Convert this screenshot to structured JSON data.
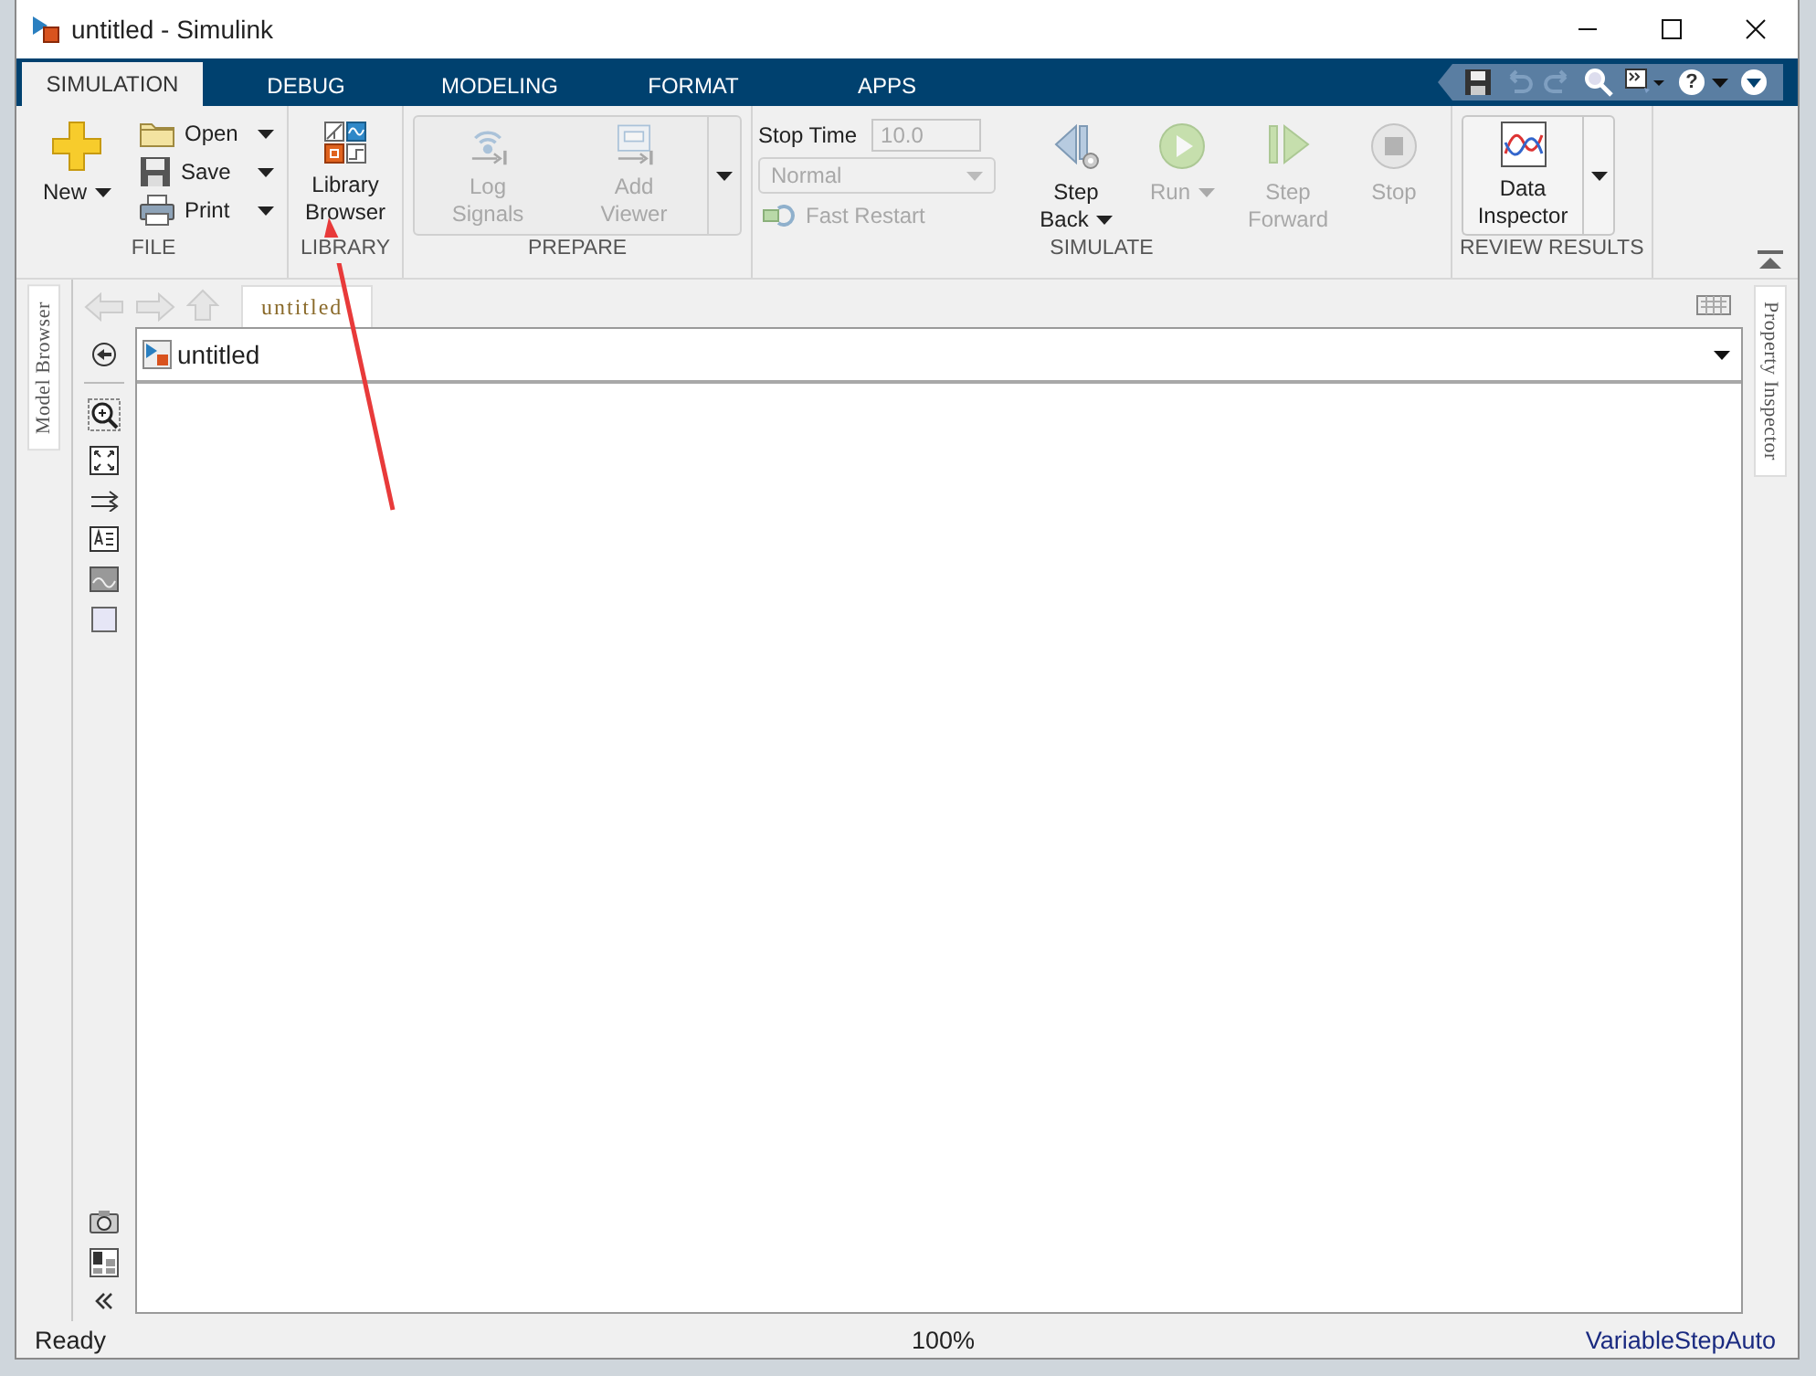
{
  "window": {
    "title": "untitled - Simulink"
  },
  "tabs": [
    {
      "label": "SIMULATION",
      "selected": true
    },
    {
      "label": "DEBUG",
      "selected": false
    },
    {
      "label": "MODELING",
      "selected": false
    },
    {
      "label": "FORMAT",
      "selected": false
    },
    {
      "label": "APPS",
      "selected": false
    }
  ],
  "quick_access": {
    "help": "?"
  },
  "toolstrip": {
    "sections": [
      {
        "title": "FILE",
        "items": [
          {
            "kind": "large",
            "label": "New",
            "disabled": false,
            "dropdown": true
          },
          {
            "kind": "column",
            "items": [
              {
                "kind": "small",
                "label": "Open",
                "disabled": false,
                "dropdown": true
              },
              {
                "kind": "small",
                "label": "Save",
                "disabled": false,
                "dropdown": true
              },
              {
                "kind": "small",
                "label": "Print",
                "disabled": false,
                "dropdown": true
              }
            ]
          }
        ]
      },
      {
        "title": "LIBRARY",
        "items": [
          {
            "kind": "large",
            "label": "Library Browser",
            "disabled": false,
            "dropdown": false
          }
        ]
      },
      {
        "title": "PREPARE",
        "items": [
          {
            "kind": "gallery",
            "items": [
              {
                "kind": "large",
                "label": "Log Signals",
                "disabled": true,
                "dropdown": false
              },
              {
                "kind": "large",
                "label": "Add Viewer",
                "disabled": true,
                "dropdown": false
              }
            ]
          }
        ]
      },
      {
        "title": "SIMULATE",
        "items": [
          {
            "kind": "column",
            "items": [
              {
                "kind": "field",
                "label": "Stop Time",
                "value": "10.0",
                "disabled": true
              },
              {
                "kind": "select",
                "value": "Normal",
                "disabled": true
              },
              {
                "kind": "toggle",
                "label": "Fast Restart",
                "disabled": true
              }
            ]
          },
          {
            "kind": "large",
            "label": "Step Back",
            "disabled": false,
            "dropdown": true
          },
          {
            "kind": "large",
            "label": "Run",
            "disabled": true,
            "dropdown": true
          },
          {
            "kind": "large",
            "label": "Step Forward",
            "disabled": true,
            "dropdown": false
          },
          {
            "kind": "large",
            "label": "Stop",
            "disabled": true,
            "dropdown": false
          }
        ]
      },
      {
        "title": "REVIEW RESULTS",
        "items": [
          {
            "kind": "split",
            "label": "Data Inspector",
            "disabled": false
          }
        ]
      }
    ]
  },
  "model_browser": {
    "label": "Model Browser"
  },
  "property_inspector": {
    "label": "Property Inspector"
  },
  "editor": {
    "tabs": [
      {
        "label": "untitled",
        "selected": true
      }
    ],
    "breadcrumb": "untitled"
  },
  "status_bar": {
    "state": "Ready",
    "zoom": "100%",
    "solver": "VariableStepAuto"
  }
}
